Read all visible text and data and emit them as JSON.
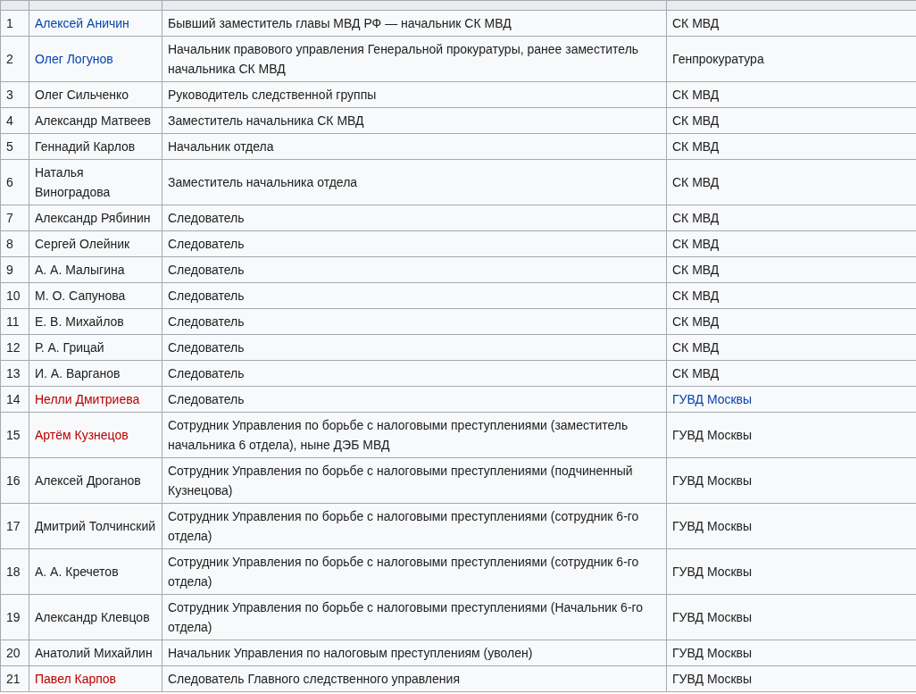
{
  "table": {
    "rows": [
      {
        "number": "1",
        "name": {
          "text": "Алексей Аничин",
          "kind": "link"
        },
        "position": "Бывший заместитель главы МВД РФ — начальник СК МВД",
        "department": {
          "text": "СК МВД",
          "kind": "plain"
        }
      },
      {
        "number": "2",
        "name": {
          "text": "Олег Логунов",
          "kind": "link"
        },
        "position": "Начальник правового управления Генеральной прокуратуры, ранее заместитель начальника СК МВД",
        "department": {
          "text": "Генпрокуратура",
          "kind": "plain"
        }
      },
      {
        "number": "3",
        "name": {
          "text": "Олег Сильченко",
          "kind": "plain"
        },
        "position": "Руководитель следственной группы",
        "department": {
          "text": "СК МВД",
          "kind": "plain"
        }
      },
      {
        "number": "4",
        "name": {
          "text": "Александр Матвеев",
          "kind": "plain"
        },
        "position": "Заместитель начальника СК МВД",
        "department": {
          "text": "СК МВД",
          "kind": "plain"
        }
      },
      {
        "number": "5",
        "name": {
          "text": "Геннадий Карлов",
          "kind": "plain"
        },
        "position": "Начальник отдела",
        "department": {
          "text": "СК МВД",
          "kind": "plain"
        }
      },
      {
        "number": "6",
        "name": {
          "text": "Наталья Виноградова",
          "kind": "plain"
        },
        "position": "Заместитель начальника отдела",
        "department": {
          "text": "СК МВД",
          "kind": "plain"
        }
      },
      {
        "number": "7",
        "name": {
          "text": "Александр Рябинин",
          "kind": "plain"
        },
        "position": "Следователь",
        "department": {
          "text": "СК МВД",
          "kind": "plain"
        }
      },
      {
        "number": "8",
        "name": {
          "text": "Сергей Олейник",
          "kind": "plain"
        },
        "position": "Следователь",
        "department": {
          "text": "СК МВД",
          "kind": "plain"
        }
      },
      {
        "number": "9",
        "name": {
          "text": "А. А. Малыгина",
          "kind": "plain"
        },
        "position": "Следователь",
        "department": {
          "text": "СК МВД",
          "kind": "plain"
        }
      },
      {
        "number": "10",
        "name": {
          "text": "М. О. Сапунова",
          "kind": "plain"
        },
        "position": "Следователь",
        "department": {
          "text": "СК МВД",
          "kind": "plain"
        }
      },
      {
        "number": "11",
        "name": {
          "text": "Е. В. Михайлов",
          "kind": "plain"
        },
        "position": "Следователь",
        "department": {
          "text": "СК МВД",
          "kind": "plain"
        }
      },
      {
        "number": "12",
        "name": {
          "text": "Р. А. Грицай",
          "kind": "plain"
        },
        "position": "Следователь",
        "department": {
          "text": "СК МВД",
          "kind": "plain"
        }
      },
      {
        "number": "13",
        "name": {
          "text": "И. А. Варганов",
          "kind": "plain"
        },
        "position": "Следователь",
        "department": {
          "text": "СК МВД",
          "kind": "plain"
        }
      },
      {
        "number": "14",
        "name": {
          "text": "Нелли Дмитриева",
          "kind": "redlink"
        },
        "position": "Следователь",
        "department": {
          "text": "ГУВД Москвы",
          "kind": "link"
        }
      },
      {
        "number": "15",
        "name": {
          "text": "Артём Кузнецов",
          "kind": "redlink"
        },
        "position": "Сотрудник Управления по борьбе с налоговыми преступлениями (заместитель начальника 6 отдела), ныне ДЭБ МВД",
        "department": {
          "text": "ГУВД Москвы",
          "kind": "plain"
        }
      },
      {
        "number": "16",
        "name": {
          "text": "Алексей Дроганов",
          "kind": "plain"
        },
        "position": "Сотрудник Управления по борьбе с налоговыми преступлениями (подчиненный Кузнецова)",
        "department": {
          "text": "ГУВД Москвы",
          "kind": "plain"
        }
      },
      {
        "number": "17",
        "name": {
          "text": "Дмитрий Толчинский",
          "kind": "plain"
        },
        "position": "Сотрудник Управления по борьбе с налоговыми преступлениями (сотрудник 6-го отдела)",
        "department": {
          "text": "ГУВД Москвы",
          "kind": "plain"
        }
      },
      {
        "number": "18",
        "name": {
          "text": "А. А. Кречетов",
          "kind": "plain"
        },
        "position": "Сотрудник Управления по борьбе с налоговыми преступлениями (сотрудник 6-го отдела)",
        "department": {
          "text": "ГУВД Москвы",
          "kind": "plain"
        }
      },
      {
        "number": "19",
        "name": {
          "text": "Александр Клевцов",
          "kind": "plain"
        },
        "position": "Сотрудник Управления по борьбе с налоговыми преступлениями (Начальник 6-го отдела)",
        "department": {
          "text": "ГУВД Москвы",
          "kind": "plain"
        }
      },
      {
        "number": "20",
        "name": {
          "text": "Анатолий Михайлин",
          "kind": "plain"
        },
        "position": "Начальник Управления по налоговым преступлениям (уволен)",
        "department": {
          "text": "ГУВД Москвы",
          "kind": "plain"
        }
      },
      {
        "number": "21",
        "name": {
          "text": "Павел Карпов",
          "kind": "redlink"
        },
        "position": "Следователь Главного следственного управления",
        "department": {
          "text": "ГУВД Москвы",
          "kind": "plain"
        }
      }
    ]
  }
}
